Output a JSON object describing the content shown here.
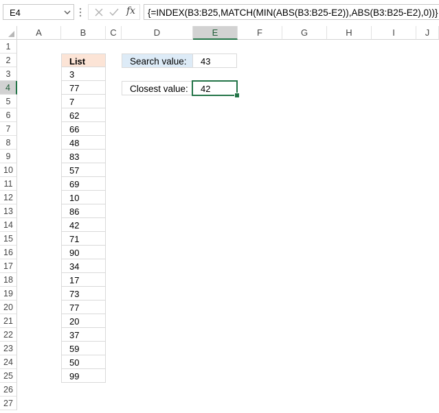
{
  "formula_bar": {
    "name_box": "E4",
    "fx_label": "fx",
    "formula": "{=INDEX(B3:B25,MATCH(MIN(ABS(B3:B25-E2)),ABS(B3:B25-E2),0))}"
  },
  "columns": [
    "A",
    "B",
    "C",
    "D",
    "E",
    "F",
    "G",
    "H",
    "I",
    "J"
  ],
  "rows": [
    "1",
    "2",
    "3",
    "4",
    "5",
    "6",
    "7",
    "8",
    "9",
    "10",
    "11",
    "12",
    "13",
    "14",
    "15",
    "16",
    "17",
    "18",
    "19",
    "20",
    "21",
    "22",
    "23",
    "24",
    "25",
    "26",
    "27"
  ],
  "selected_column": "E",
  "selected_row": "4",
  "list": {
    "header": "List",
    "values": [
      "3",
      "77",
      "7",
      "62",
      "66",
      "48",
      "83",
      "57",
      "69",
      "10",
      "86",
      "42",
      "71",
      "90",
      "34",
      "17",
      "73",
      "77",
      "20",
      "37",
      "59",
      "50",
      "99"
    ]
  },
  "search": {
    "label": "Search value:",
    "value": "43"
  },
  "closest": {
    "label": "Closest value:",
    "value": "42"
  },
  "colors": {
    "list_header_fill": "#fce4d6",
    "search_label_fill": "#ddebf7",
    "selection_green": "#217346"
  }
}
